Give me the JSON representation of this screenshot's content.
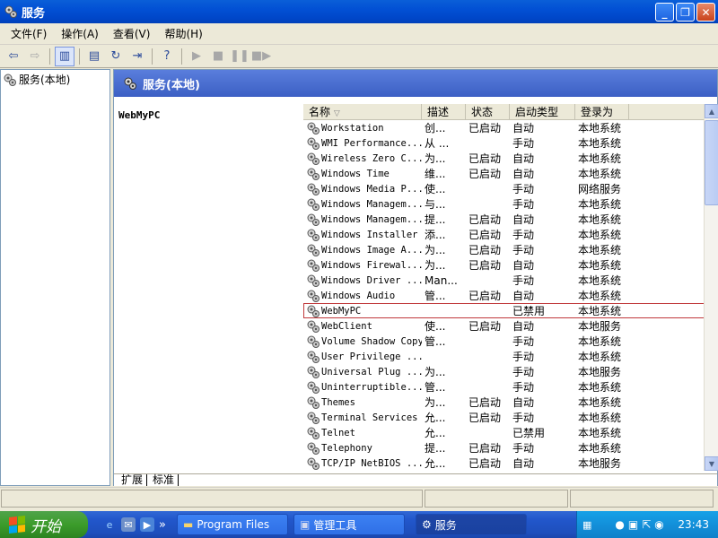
{
  "window": {
    "title": "服务",
    "min": "_",
    "restore": "❐",
    "close": "✕"
  },
  "menu": [
    "文件(F)",
    "操作(A)",
    "查看(V)",
    "帮助(H)"
  ],
  "tree": {
    "root_label": "服务(本地)"
  },
  "pane": {
    "header_title": "服务(本地)",
    "selected_name": "WebMyPC",
    "columns": [
      "名称",
      "描述",
      "状态",
      "启动类型",
      "登录为"
    ],
    "sort_indicator": "▽",
    "rows": [
      {
        "name": "Workstation",
        "desc": "创...",
        "status": "已启动",
        "startup": "自动",
        "logon": "本地系统"
      },
      {
        "name": "WMI Performance...",
        "desc": "从 ...",
        "status": "",
        "startup": "手动",
        "logon": "本地系统"
      },
      {
        "name": "Wireless Zero C...",
        "desc": "为...",
        "status": "已启动",
        "startup": "自动",
        "logon": "本地系统"
      },
      {
        "name": "Windows Time",
        "desc": "维...",
        "status": "已启动",
        "startup": "自动",
        "logon": "本地系统"
      },
      {
        "name": "Windows Media P...",
        "desc": "使...",
        "status": "",
        "startup": "手动",
        "logon": "网络服务"
      },
      {
        "name": "Windows Managem...",
        "desc": "与...",
        "status": "",
        "startup": "手动",
        "logon": "本地系统"
      },
      {
        "name": "Windows Managem...",
        "desc": "提...",
        "status": "已启动",
        "startup": "自动",
        "logon": "本地系统"
      },
      {
        "name": "Windows Installer",
        "desc": "添...",
        "status": "已启动",
        "startup": "手动",
        "logon": "本地系统"
      },
      {
        "name": "Windows Image A...",
        "desc": "为...",
        "status": "已启动",
        "startup": "手动",
        "logon": "本地系统"
      },
      {
        "name": "Windows Firewal...",
        "desc": "为...",
        "status": "已启动",
        "startup": "自动",
        "logon": "本地系统"
      },
      {
        "name": "Windows Driver ...",
        "desc": "Man...",
        "status": "",
        "startup": "手动",
        "logon": "本地系统"
      },
      {
        "name": "Windows Audio",
        "desc": "管...",
        "status": "已启动",
        "startup": "自动",
        "logon": "本地系统"
      },
      {
        "name": "WebMyPC",
        "desc": "",
        "status": "",
        "startup": "已禁用",
        "logon": "本地系统"
      },
      {
        "name": "WebClient",
        "desc": "使...",
        "status": "已启动",
        "startup": "自动",
        "logon": "本地服务"
      },
      {
        "name": "Volume Shadow Copy",
        "desc": "管...",
        "status": "",
        "startup": "手动",
        "logon": "本地系统"
      },
      {
        "name": "User Privilege ...",
        "desc": "",
        "status": "",
        "startup": "手动",
        "logon": "本地系统"
      },
      {
        "name": "Universal Plug ...",
        "desc": "为...",
        "status": "",
        "startup": "手动",
        "logon": "本地服务"
      },
      {
        "name": "Uninterruptible...",
        "desc": "管...",
        "status": "",
        "startup": "手动",
        "logon": "本地系统"
      },
      {
        "name": "Themes",
        "desc": "为...",
        "status": "已启动",
        "startup": "自动",
        "logon": "本地系统"
      },
      {
        "name": "Terminal Services",
        "desc": "允...",
        "status": "已启动",
        "startup": "手动",
        "logon": "本地系统"
      },
      {
        "name": "Telnet",
        "desc": "允...",
        "status": "",
        "startup": "已禁用",
        "logon": "本地系统"
      },
      {
        "name": "Telephony",
        "desc": "提...",
        "status": "已启动",
        "startup": "手动",
        "logon": "本地系统"
      },
      {
        "name": "TCP/IP NetBIOS ...",
        "desc": "允...",
        "status": "已启动",
        "startup": "自动",
        "logon": "本地服务"
      }
    ],
    "tabs": [
      "扩展",
      "标准"
    ]
  },
  "taskbar": {
    "start_label": "开始",
    "tasks": [
      {
        "label": "Program Files"
      },
      {
        "label": "管理工具"
      },
      {
        "label": "服务"
      }
    ],
    "clock": "23:43"
  }
}
